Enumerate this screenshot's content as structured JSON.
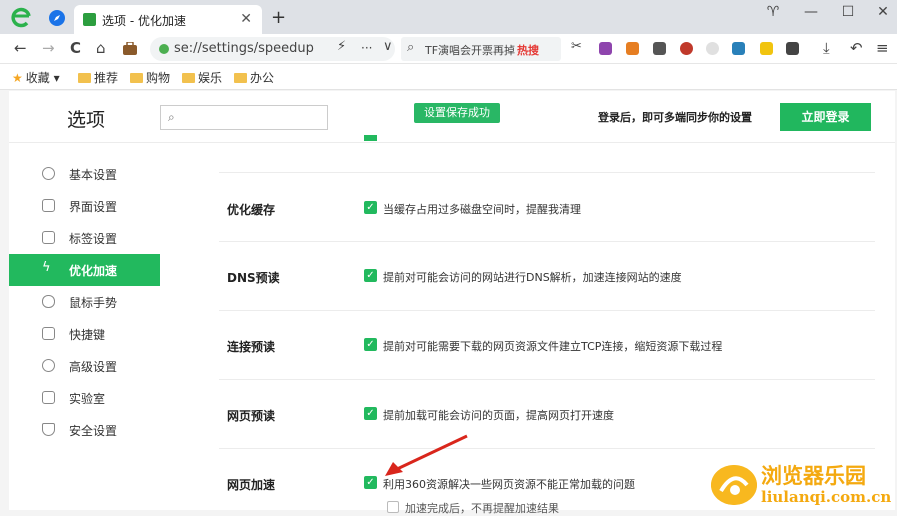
{
  "browser": {
    "tab_title": "选项 - 优化加速",
    "tab_close": "✕",
    "new_tab": "+",
    "win_skin": "♈",
    "win_min": "—",
    "win_max": "☐",
    "win_close": "✕"
  },
  "toolbar": {
    "back": "←",
    "forward": "→",
    "reload": "C",
    "home": "⌂",
    "address": "se://settings/speedup",
    "bolt": "⚡",
    "more": "···",
    "dropdown": "∨",
    "search_hint": "TF演唱会开票再掉",
    "hot_label": "热搜",
    "cut": "✂",
    "download": "⤓",
    "undo": "↶",
    "menu": "≡"
  },
  "bookmarks": {
    "fav": "收藏",
    "items": [
      "推荐",
      "购物",
      "娱乐",
      "办公"
    ]
  },
  "header": {
    "title": "选项",
    "search_placeholder": "",
    "toast": "设置保存成功",
    "sync_text": "登录后，即可多端同步你的设置",
    "login_button": "立即登录"
  },
  "sidebar": {
    "items": [
      {
        "label": "基本设置",
        "icon": "gear-icon"
      },
      {
        "label": "界面设置",
        "icon": "window-icon"
      },
      {
        "label": "标签设置",
        "icon": "tab-icon"
      },
      {
        "label": "优化加速",
        "icon": "bolt-icon"
      },
      {
        "label": "鼠标手势",
        "icon": "mouse-icon"
      },
      {
        "label": "快捷键",
        "icon": "keyboard-icon"
      },
      {
        "label": "高级设置",
        "icon": "wrench-icon"
      },
      {
        "label": "实验室",
        "icon": "flask-icon"
      },
      {
        "label": "安全设置",
        "icon": "shield-icon"
      }
    ]
  },
  "settings": {
    "rows": [
      {
        "label": "优化缓存",
        "desc": "当缓存占用过多磁盘空间时，提醒我清理",
        "checked": true
      },
      {
        "label": "DNS预读",
        "desc": "提前对可能会访问的网站进行DNS解析，加速连接网站的速度",
        "checked": true
      },
      {
        "label": "连接预读",
        "desc": "提前对可能需要下载的网页资源文件建立TCP连接，缩短资源下载过程",
        "checked": true
      },
      {
        "label": "网页预读",
        "desc": "提前加载可能会访问的页面，提高网页打开速度",
        "checked": true
      },
      {
        "label": "网页加速",
        "desc": "利用360资源解决一些网页资源不能正常加载的问题",
        "checked": true
      }
    ],
    "sub_option": "加速完成后，不再提醒加速结果",
    "check_mark": "✓"
  },
  "watermark": {
    "name": "浏览器乐园",
    "url": "liulanqi.com.cn"
  },
  "colors": {
    "accent": "#22b95e",
    "watermark": "#f4a90f"
  }
}
